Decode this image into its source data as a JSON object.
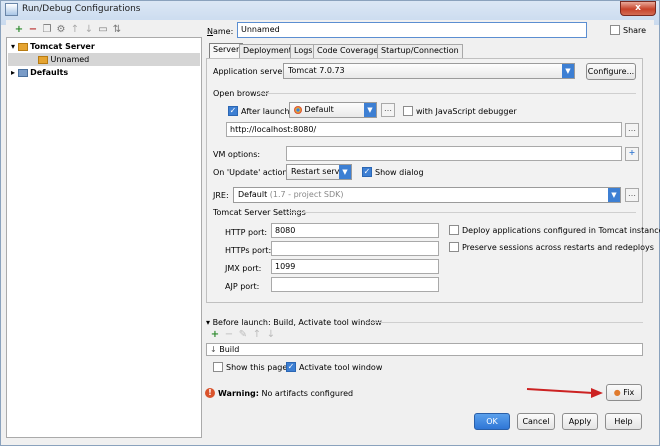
{
  "window": {
    "title": "Run/Debug Configurations",
    "close_glyph": "x"
  },
  "toolbar": {
    "icons": [
      "add-icon",
      "remove-icon",
      "copy-icon",
      "settings-icon",
      "move-up-icon",
      "move-down-icon",
      "folder-icon",
      "sort-icon"
    ]
  },
  "tree": {
    "items": [
      {
        "label": "Tomcat Server",
        "expanded": true
      },
      {
        "label": "Unnamed",
        "selected": true
      },
      {
        "label": "Defaults",
        "expanded": false
      }
    ]
  },
  "name": {
    "label": "Name:",
    "value": "Unnamed"
  },
  "share": {
    "label": "Share",
    "checked": false
  },
  "tabs": [
    {
      "label": "Server",
      "active": true
    },
    {
      "label": "Deployment"
    },
    {
      "label": "Logs"
    },
    {
      "label": "Code Coverage"
    },
    {
      "label": "Startup/Connection"
    }
  ],
  "server": {
    "app_server_label": "Application server:",
    "app_server_value": "Tomcat 7.0.73",
    "configure_button": "Configure...",
    "open_browser_title": "Open browser",
    "after_launch_label": "After launch",
    "after_launch_checked": true,
    "browser_value": "Default",
    "js_debugger_label": "with JavaScript debugger",
    "js_debugger_checked": false,
    "url_value": "http://localhost:8080/",
    "vm_options_label": "VM options:",
    "vm_options_value": "",
    "update_action_label": "On 'Update' action:",
    "update_action_value": "Restart server",
    "show_dialog_label": "Show dialog",
    "show_dialog_checked": true,
    "jre_label": "JRE:",
    "jre_value": "Default",
    "jre_hint": "(1.7 - project SDK)",
    "tomcat_settings_title": "Tomcat Server Settings",
    "http_port_label": "HTTP port:",
    "http_port_value": "8080",
    "https_port_label": "HTTPs port:",
    "https_port_value": "",
    "jmx_port_label": "JMX port:",
    "jmx_port_value": "1099",
    "ajp_port_label": "AJP port:",
    "ajp_port_value": "",
    "deploy_label": "Deploy applications configured in Tomcat instance",
    "deploy_checked": false,
    "preserve_label": "Preserve sessions across restarts and redeploys",
    "preserve_checked": false
  },
  "before_launch": {
    "title": "Before launch: Build, Activate tool window",
    "item": "Build",
    "show_page_label": "Show this page",
    "show_page_checked": false,
    "activate_label": "Activate tool window",
    "activate_checked": true
  },
  "warning": {
    "prefix": "Warning:",
    "message": "No artifacts configured",
    "fix_button": "Fix"
  },
  "buttons": {
    "ok": "OK",
    "cancel": "Cancel",
    "apply": "Apply",
    "help": "Help"
  },
  "colors": {
    "accent": "#3d7fd3",
    "arrow": "#cc2222",
    "warning": "#d9532c"
  }
}
